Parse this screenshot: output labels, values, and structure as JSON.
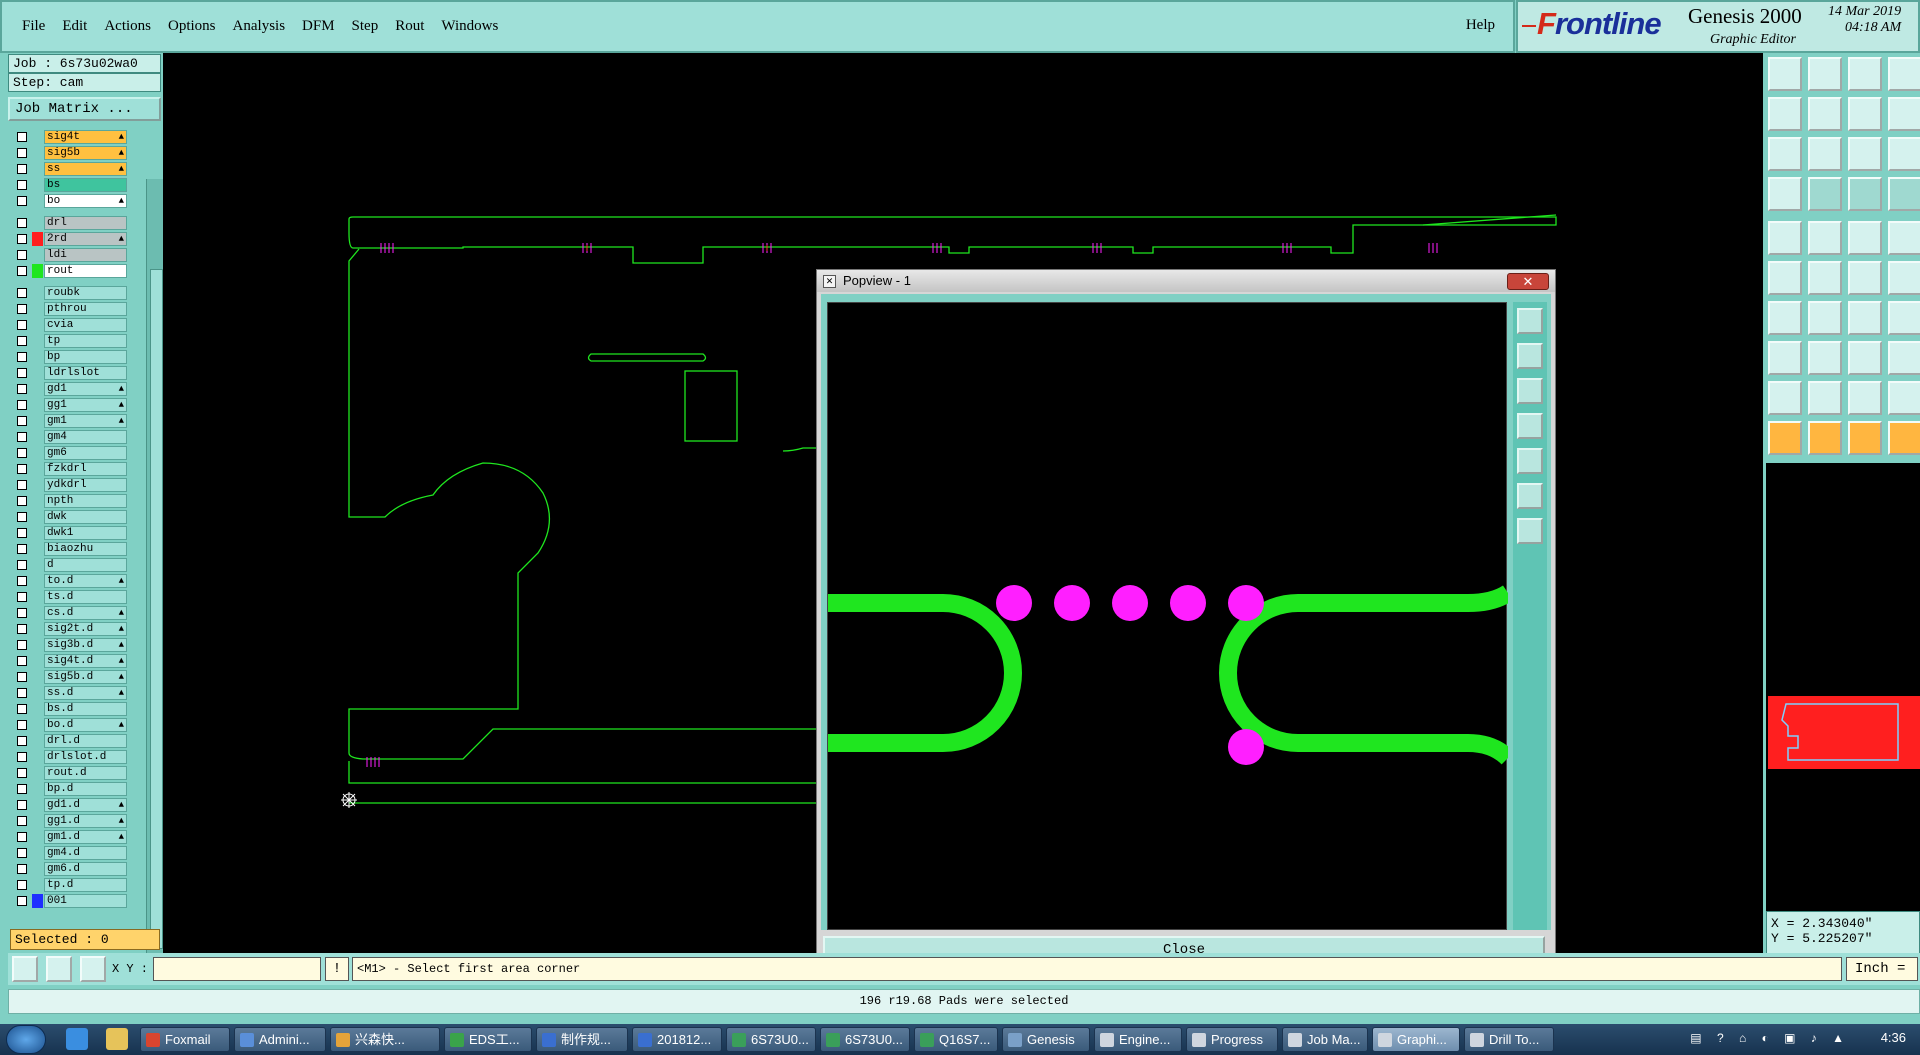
{
  "menubar": {
    "items": [
      "File",
      "Edit",
      "Actions",
      "Options",
      "Analysis",
      "DFM",
      "Step",
      "Rout",
      "Windows"
    ],
    "help": "Help"
  },
  "brand": {
    "logo": "Frontline",
    "product": "Genesis 2000",
    "subtitle": "Graphic Editor",
    "date": "14 Mar 2019",
    "time": "04:18 AM"
  },
  "job": {
    "job_label": "Job : 6s73u02wa0",
    "step_label": "Step: cam",
    "matrix_button": "Job Matrix ..."
  },
  "layers_group1": [
    {
      "name": "sig4t",
      "color": "#ffc040",
      "flag": true
    },
    {
      "name": "sig5b",
      "color": "#ffc040",
      "flag": true
    },
    {
      "name": "ss",
      "color": "#ffc040",
      "flag": true
    },
    {
      "name": "bs",
      "color": "#3fc49e",
      "flag": false
    },
    {
      "name": "bo",
      "color": "#ffffff",
      "flag": true
    }
  ],
  "layers_group2": [
    {
      "name": "drl",
      "color": "#b9c4c4",
      "flag": false,
      "swatch": ""
    },
    {
      "name": "2rd",
      "color": "#b9c4c4",
      "flag": true,
      "swatch": "#ff1f1f"
    },
    {
      "name": "ldi",
      "color": "#b9c4c4",
      "flag": false,
      "swatch": ""
    },
    {
      "name": "rout",
      "color": "#ffffff",
      "flag": false,
      "swatch": "#1fe61f"
    }
  ],
  "layers_group3": [
    {
      "name": "roubk",
      "flag": false
    },
    {
      "name": "pthrou",
      "flag": false
    },
    {
      "name": "cvia",
      "flag": false
    },
    {
      "name": "tp",
      "flag": false
    },
    {
      "name": "bp",
      "flag": false
    },
    {
      "name": "ldrlslot",
      "flag": false
    },
    {
      "name": "gd1",
      "flag": true
    },
    {
      "name": "gg1",
      "flag": true
    },
    {
      "name": "gm1",
      "flag": true
    },
    {
      "name": "gm4",
      "flag": false
    },
    {
      "name": "gm6",
      "flag": false
    },
    {
      "name": "fzkdrl",
      "flag": false
    },
    {
      "name": "ydkdrl",
      "flag": false
    },
    {
      "name": "npth",
      "flag": false
    },
    {
      "name": "dwk",
      "flag": false
    },
    {
      "name": "dwk1",
      "flag": false
    },
    {
      "name": "biaozhu",
      "flag": false
    },
    {
      "name": "d",
      "flag": false
    },
    {
      "name": "to.d",
      "flag": true
    },
    {
      "name": "ts.d",
      "flag": false
    },
    {
      "name": "cs.d",
      "flag": true
    },
    {
      "name": "sig2t.d",
      "flag": true
    },
    {
      "name": "sig3b.d",
      "flag": true
    },
    {
      "name": "sig4t.d",
      "flag": true
    },
    {
      "name": "sig5b.d",
      "flag": true
    },
    {
      "name": "ss.d",
      "flag": true
    },
    {
      "name": "bs.d",
      "flag": false
    },
    {
      "name": "bo.d",
      "flag": true
    },
    {
      "name": "drl.d",
      "flag": false
    },
    {
      "name": "drlslot.d",
      "flag": false
    },
    {
      "name": "rout.d",
      "flag": false
    },
    {
      "name": "bp.d",
      "flag": false
    },
    {
      "name": "gd1.d",
      "flag": true
    },
    {
      "name": "gg1.d",
      "flag": true
    },
    {
      "name": "gm1.d",
      "flag": true
    },
    {
      "name": "gm4.d",
      "flag": false
    },
    {
      "name": "gm6.d",
      "flag": false
    },
    {
      "name": "tp.d",
      "flag": false
    },
    {
      "name": "001",
      "flag": false,
      "swatch": "#1f2fff"
    }
  ],
  "selected": "Selected : 0",
  "popview": {
    "title": "Popview - 1",
    "close_x": "✕",
    "close_button": "Close",
    "tools": [
      "zoom-fit-icon",
      "zoom-in-icon",
      "zoom-out-icon",
      "pan-left-icon",
      "pan-right-icon",
      "expand-icon",
      "center-icon"
    ]
  },
  "coordinates": {
    "x": "X = 2.343040\"",
    "y": "Y = 5.225207\""
  },
  "cmdline": {
    "xy_label": "X Y :",
    "xy_value": "",
    "excl": "!",
    "prompt": "<M1> - Select first area corner",
    "unit": "Inch ="
  },
  "status": "196 r19.68 Pads were selected",
  "taskbar": {
    "tasks": [
      {
        "label": "Foxmail",
        "color": "#d9452f"
      },
      {
        "label": "Admini...",
        "color": "#5a8fd9"
      },
      {
        "label": "兴森快...",
        "color": "#e4a33a"
      },
      {
        "label": "EDS工...",
        "color": "#3aa34a"
      },
      {
        "label": "制作规...",
        "color": "#3a6fd0"
      },
      {
        "label": "201812...",
        "color": "#3a6fd0"
      },
      {
        "label": "6S73U0...",
        "color": "#3a9f5a"
      },
      {
        "label": "6S73U0...",
        "color": "#3a9f5a"
      },
      {
        "label": "Q16S7...",
        "color": "#3a9f5a"
      },
      {
        "label": "Genesis",
        "color": "#7aa0c8"
      },
      {
        "label": "Engine...",
        "color": "#cfd6df"
      },
      {
        "label": "Progress",
        "color": "#cfd6df"
      },
      {
        "label": "Job Ma...",
        "color": "#cfd6df"
      },
      {
        "label": "Graphi...",
        "color": "#cfd6df"
      },
      {
        "label": "Drill To...",
        "color": "#cfd6df"
      }
    ],
    "clock": "4:36"
  },
  "colors": {
    "board_outline": "#1fe61f",
    "drill_pads": "#ff1fff",
    "canvas_bg": "#000000",
    "panel_bg": "#80d0c4"
  }
}
